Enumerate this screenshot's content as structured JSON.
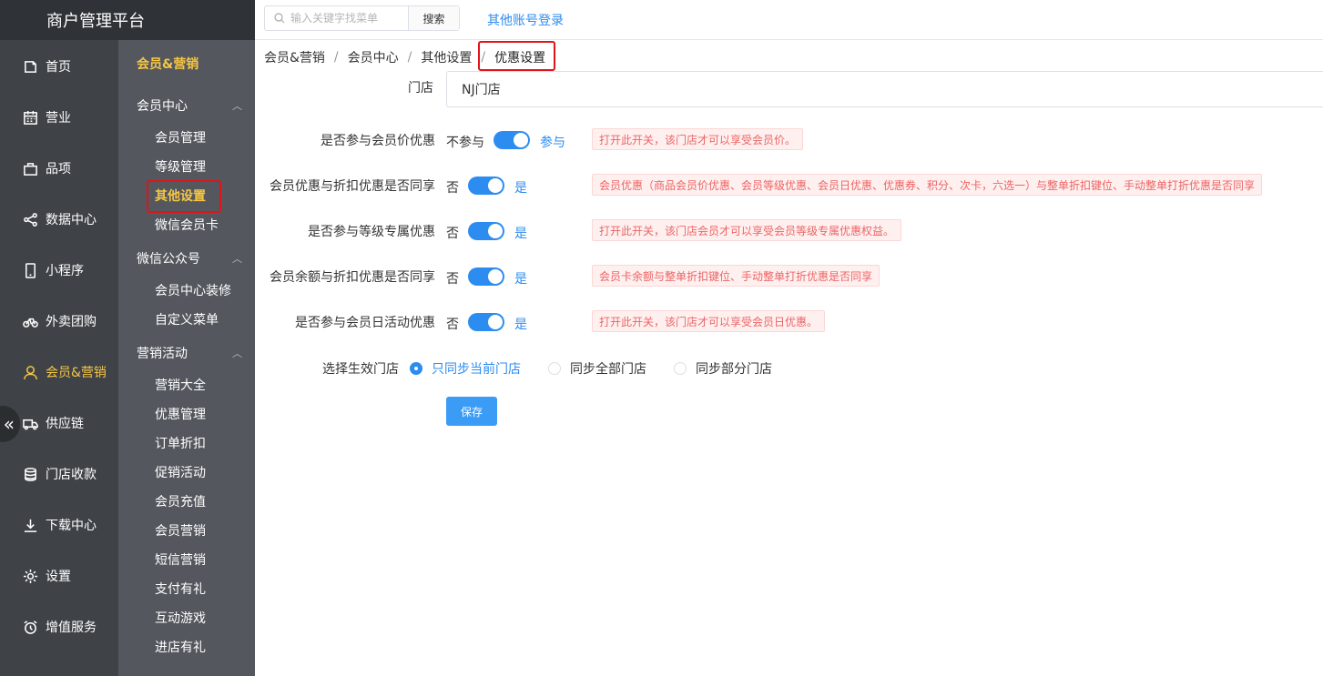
{
  "app": {
    "title": "商户管理平台"
  },
  "topbar": {
    "search_placeholder": "输入关键字找菜单",
    "search_button": "搜索",
    "other_login": "其他账号登录"
  },
  "nav_primary": [
    {
      "label": "首页",
      "icon": "home-icon"
    },
    {
      "label": "营业",
      "icon": "calendar-icon"
    },
    {
      "label": "品项",
      "icon": "bag-icon"
    },
    {
      "label": "数据中心",
      "icon": "share-icon"
    },
    {
      "label": "小程序",
      "icon": "phone-icon"
    },
    {
      "label": "外卖团购",
      "icon": "bike-icon"
    },
    {
      "label": "会员&营销",
      "icon": "user-icon",
      "active": true
    },
    {
      "label": "供应链",
      "icon": "truck-icon"
    },
    {
      "label": "门店收款",
      "icon": "coins-icon"
    },
    {
      "label": "下载中心",
      "icon": "download-icon"
    },
    {
      "label": "设置",
      "icon": "gear-icon"
    },
    {
      "label": "增值服务",
      "icon": "alarm-icon"
    }
  ],
  "nav_secondary": {
    "heading": "会员&营销",
    "groups": [
      {
        "label": "会员中心",
        "items": [
          "会员管理",
          "等级管理",
          "其他设置",
          "微信会员卡"
        ]
      },
      {
        "label": "微信公众号",
        "items": [
          "会员中心装修",
          "自定义菜单"
        ]
      },
      {
        "label": "营销活动",
        "items": [
          "营销大全",
          "优惠管理",
          "订单折扣",
          "促销活动",
          "会员充值",
          "会员营销",
          "短信营销",
          "支付有礼",
          "互动游戏",
          "进店有礼"
        ]
      }
    ],
    "active_item": "其他设置"
  },
  "breadcrumb": [
    "会员&营销",
    "会员中心",
    "其他设置",
    "优惠设置"
  ],
  "breadcrumb_sep": "/",
  "form": {
    "store_label": "门店",
    "store_value": "NJ门店",
    "switches": [
      {
        "label": "是否参与会员价优惠",
        "off": "不参与",
        "on": "参与",
        "value": true,
        "hint": "打开此开关，该门店才可以享受会员价。"
      },
      {
        "label": "会员优惠与折扣优惠是否同享",
        "off": "否",
        "on": "是",
        "value": true,
        "hint": "会员优惠（商品会员价优惠、会员等级优惠、会员日优惠、优惠券、积分、次卡，六选一）与整单折扣键位、手动整单打折优惠是否同享"
      },
      {
        "label": "是否参与等级专属优惠",
        "off": "否",
        "on": "是",
        "value": true,
        "hint": "打开此开关，该门店会员才可以享受会员等级专属优惠权益。"
      },
      {
        "label": "会员余额与折扣优惠是否同享",
        "off": "否",
        "on": "是",
        "value": true,
        "hint": "会员卡余额与整单折扣键位、手动整单打折优惠是否同享"
      },
      {
        "label": "是否参与会员日活动优惠",
        "off": "否",
        "on": "是",
        "value": true,
        "hint": "打开此开关，该门店才可以享受会员日优惠。"
      }
    ],
    "sync_label": "选择生效门店",
    "sync_options": [
      "只同步当前门店",
      "同步全部门店",
      "同步部分门店"
    ],
    "sync_selected": "只同步当前门店",
    "save": "保存"
  },
  "colors": {
    "accent": "#2d8cf0",
    "highlight": "#e0141a",
    "active_nav": "#f5c645",
    "hint_text": "#ec6464"
  }
}
